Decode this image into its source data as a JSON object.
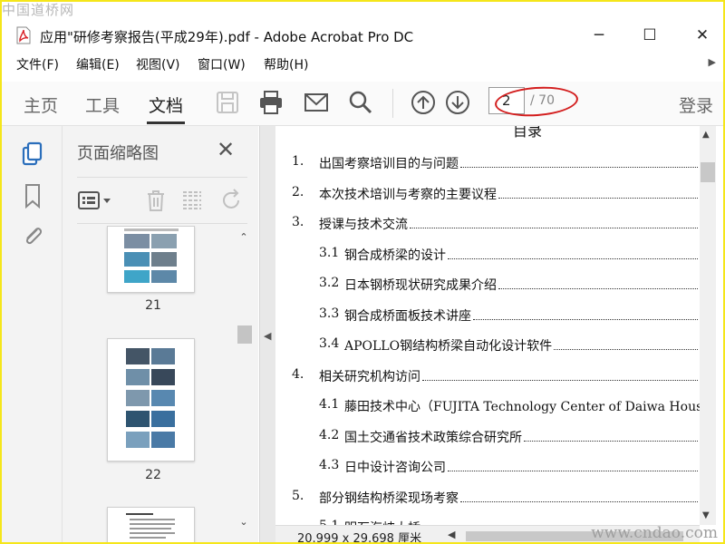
{
  "watermarks": {
    "top": "中国道桥网",
    "bottom": "www.cndao.com"
  },
  "window": {
    "title": "应用\"研修考察报告(平成29年).pdf - Adobe Acrobat Pro DC",
    "controls": {
      "minimize": "─",
      "maximize": "☐",
      "close": "✕"
    }
  },
  "menu": [
    "文件(F)",
    "编辑(E)",
    "视图(V)",
    "窗口(W)",
    "帮助(H)"
  ],
  "toolbar": {
    "tabs": [
      "主页",
      "工具",
      "文档"
    ],
    "active_tab": "文档",
    "page_current": "2",
    "page_total": "/ 70",
    "login": "登录",
    "icons": [
      "save-icon",
      "print-icon",
      "mail-icon",
      "search-icon",
      "page-up-icon",
      "page-down-icon"
    ]
  },
  "rail": {
    "icons": [
      "pages-icon",
      "bookmark-icon",
      "attachment-icon"
    ]
  },
  "panel": {
    "title": "页面缩略图",
    "close": "✕",
    "tools": [
      "thumbnail-options-icon",
      "delete-icon",
      "extract-icon",
      "rotate-icon"
    ],
    "thumbnails": [
      {
        "label": "21"
      },
      {
        "label": "22"
      },
      {
        "label": ""
      }
    ]
  },
  "document": {
    "heading": "目录",
    "toc": [
      {
        "num": "1.",
        "text": "出国考察培训目的与问题",
        "level": 1
      },
      {
        "num": "2.",
        "text": "本次技术培训与考察的主要议程",
        "level": 1
      },
      {
        "num": "3.",
        "text": "授课与技术交流",
        "level": 1
      },
      {
        "num": "3.1",
        "text": "钢合成桥梁的设计",
        "level": 2
      },
      {
        "num": "3.2",
        "text": "日本钢桥现状研究成果介绍",
        "level": 2
      },
      {
        "num": "3.3",
        "text": "钢合成桥面板技术讲座",
        "level": 2
      },
      {
        "num": "3.4",
        "text": "APOLLO钢结构桥梁自动化设计软件",
        "level": 2
      },
      {
        "num": "4.",
        "text": "相关研究机构访问",
        "level": 1
      },
      {
        "num": "4.1",
        "text": "藤田技术中心（FUJITA Technology Center of Daiwa House Grou",
        "level": 2
      },
      {
        "num": "4.2",
        "text": "国土交通省技术政策综合研究所",
        "level": 2
      },
      {
        "num": "4.3",
        "text": "日中设计咨询公司",
        "level": 2
      },
      {
        "num": "5.",
        "text": "部分钢结构桥梁现场考察",
        "level": 1
      },
      {
        "num": "5.1",
        "text": "明石海峡大桥",
        "level": 2
      }
    ]
  },
  "statusbar": {
    "dimensions": "20.999 x 29.698 厘米"
  }
}
